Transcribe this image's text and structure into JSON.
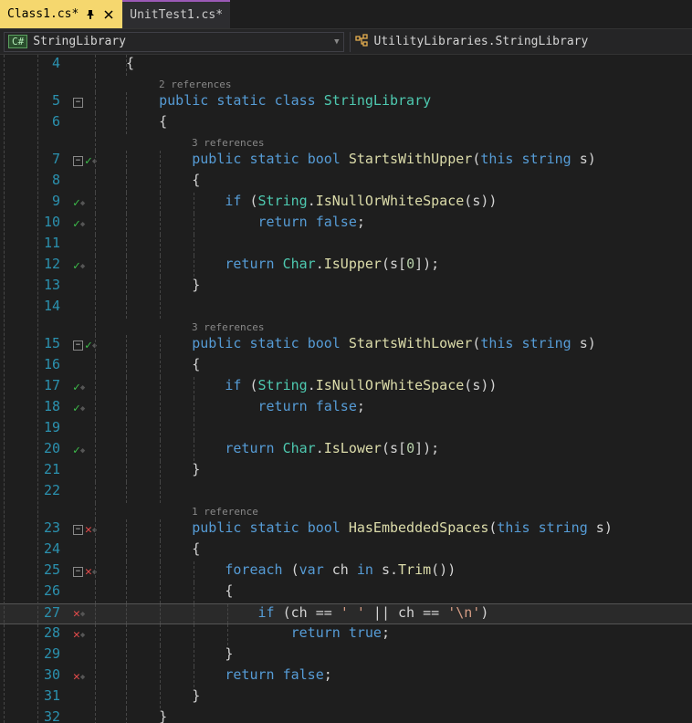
{
  "tabs": {
    "active": "Class1.cs*",
    "inactive": "UnitTest1.cs*"
  },
  "nav": {
    "left_badge": "C#",
    "left_text": "StringLibrary",
    "right_text": "UtilityLibraries.StringLibrary"
  },
  "codelens": {
    "class": "2 references",
    "m1": "3 references",
    "m2": "3 references",
    "m3": "1 reference"
  },
  "code": {
    "l4": "{",
    "l5_1": "public",
    "l5_2": "static",
    "l5_3": "class",
    "l5_4": "StringLibrary",
    "l6": "{",
    "l7_1": "public",
    "l7_2": "static",
    "l7_3": "bool",
    "l7_4": "StartsWithUpper",
    "l7_5": "this",
    "l7_6": "string",
    "l7_7": "s",
    "l8": "{",
    "l9_1": "if",
    "l9_2": "String",
    "l9_3": "IsNullOrWhiteSpace",
    "l9_4": "s",
    "l10_1": "return",
    "l10_2": "false",
    "l12_1": "return",
    "l12_2": "Char",
    "l12_3": "IsUpper",
    "l12_4": "s",
    "l12_5": "0",
    "l13": "}",
    "l15_4": "StartsWithLower",
    "l20_3": "IsLower",
    "l23_4": "HasEmbeddedSpaces",
    "l25_1": "foreach",
    "l25_2": "var",
    "l25_3": "ch",
    "l25_4": "in",
    "l25_5": "s",
    "l25_6": "Trim",
    "l27_1": "if",
    "l27_2": "ch",
    "l27_3": "' '",
    "l27_4": "ch",
    "l27_5": "'\\n'",
    "l28_1": "return",
    "l28_2": "true",
    "l30_1": "return",
    "l30_2": "false",
    "l31": "}",
    "l32": "}"
  },
  "linenos": [
    "4",
    "5",
    "6",
    "7",
    "8",
    "9",
    "10",
    "11",
    "12",
    "13",
    "14",
    "15",
    "16",
    "17",
    "18",
    "19",
    "20",
    "21",
    "22",
    "23",
    "24",
    "25",
    "26",
    "27",
    "28",
    "29",
    "30",
    "31",
    "32"
  ]
}
